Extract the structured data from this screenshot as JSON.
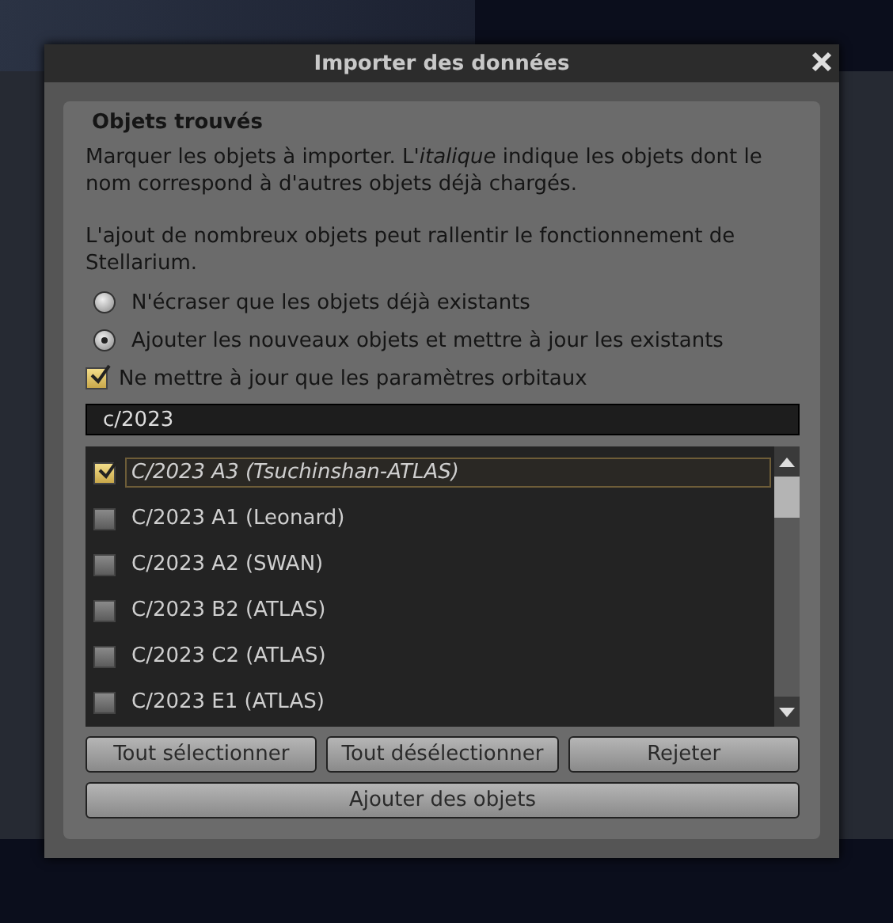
{
  "window": {
    "title": "Importer des données"
  },
  "section": {
    "title": "Objets trouvés",
    "intro": "Marquer les objets à importer. L'*italique* indique les objets dont le nom correspond à d'autres objets déjà chargés.",
    "warning": "L'ajout de nombreux objets peut rallentir le fonctionnement de Stellarium."
  },
  "options": [
    {
      "kind": "radio",
      "label": "N'écraser que les objets déjà existants",
      "selected": false
    },
    {
      "kind": "radio",
      "label": "Ajouter les nouveaux objets et mettre à jour les existants",
      "selected": true
    },
    {
      "kind": "checkbox",
      "label": "Ne mettre à jour que les paramètres orbitaux",
      "checked": true
    }
  ],
  "filter": {
    "value": "c/2023"
  },
  "objects": [
    {
      "name": "C/2023 A3 (Tsuchinshan-ATLAS)",
      "checked": true,
      "existing": true,
      "selected": true
    },
    {
      "name": "C/2023 A1 (Leonard)",
      "checked": false,
      "existing": false,
      "selected": false
    },
    {
      "name": "C/2023 A2 (SWAN)",
      "checked": false,
      "existing": false,
      "selected": false
    },
    {
      "name": "C/2023 B2 (ATLAS)",
      "checked": false,
      "existing": false,
      "selected": false
    },
    {
      "name": "C/2023 C2 (ATLAS)",
      "checked": false,
      "existing": false,
      "selected": false
    },
    {
      "name": "C/2023 E1 (ATLAS)",
      "checked": false,
      "existing": false,
      "selected": false
    }
  ],
  "buttons": [
    "Tout sélectionner",
    "Tout désélectionner",
    "Rejeter"
  ],
  "add_button": "Ajouter des objets"
}
